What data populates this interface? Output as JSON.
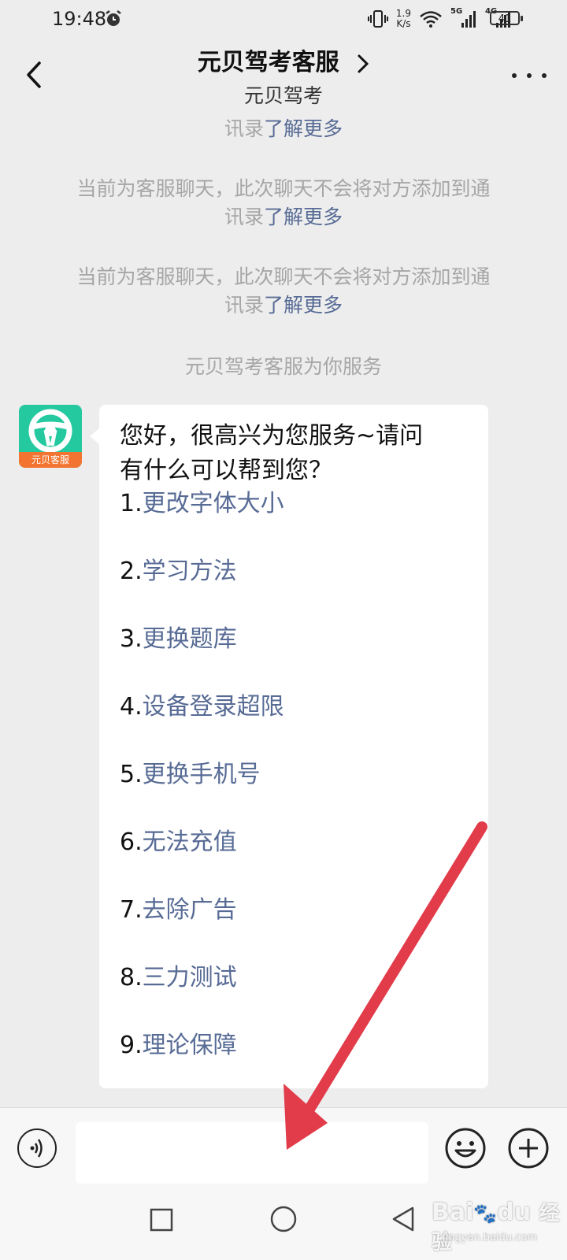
{
  "status_bar": {
    "time": "19:48",
    "net_speed_value": "1.9",
    "net_speed_unit": "K/s",
    "sim1": "5G",
    "sim2": "4G",
    "battery": "41"
  },
  "header": {
    "title": "元贝驾考客服",
    "subtitle": "元贝驾考"
  },
  "system_messages": [
    {
      "text": "讯录",
      "link": "了解更多"
    },
    {
      "text": "当前为客服聊天，此次聊天不会将对方添加到通",
      "text2": "讯录",
      "link": "了解更多"
    },
    {
      "text": "当前为客服聊天，此次聊天不会将对方添加到通",
      "text2": "讯录",
      "link": "了解更多"
    },
    {
      "text": "元贝驾考客服为你服务"
    }
  ],
  "avatar": {
    "label": "元贝客服",
    "color": "#25c9a0",
    "band_color": "#f27430"
  },
  "message": {
    "greeting_line1": "您好，很高兴为您服务~请问",
    "greeting_line2": "有什么可以帮到您？",
    "options": [
      {
        "num": "1.",
        "label": "更改字体大小"
      },
      {
        "num": "2.",
        "label": "学习方法"
      },
      {
        "num": "3.",
        "label": "更换题库"
      },
      {
        "num": "4.",
        "label": "设备登录超限"
      },
      {
        "num": "5.",
        "label": "更换手机号"
      },
      {
        "num": "6.",
        "label": "无法充值"
      },
      {
        "num": "7.",
        "label": "去除广告"
      },
      {
        "num": "8.",
        "label": "三力测试"
      },
      {
        "num": "9.",
        "label": "理论保障"
      }
    ]
  },
  "input": {
    "value": "",
    "placeholder": ""
  },
  "watermark": {
    "brand": "Bai",
    "brand2": "du",
    "cn": "经验",
    "url": "jingyan.baidu.com"
  },
  "colors": {
    "link": "#576b95",
    "background": "#ededed",
    "arrow": "#e23b4a"
  }
}
